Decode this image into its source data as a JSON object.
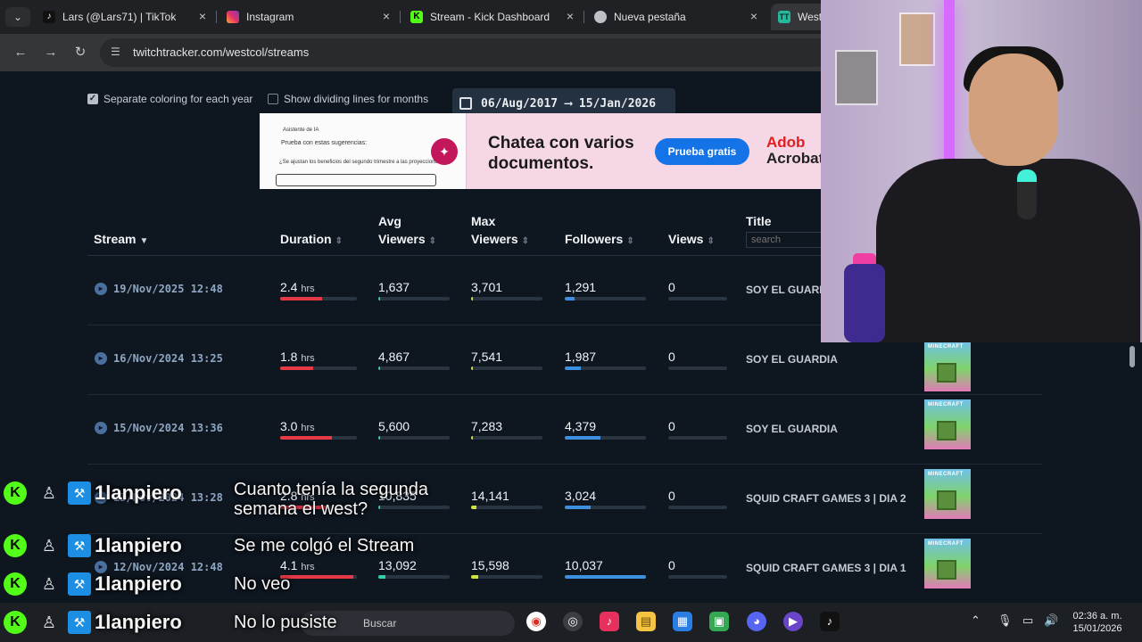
{
  "browser": {
    "tabs": [
      {
        "title": "Lars (@Lars71) | TikTok",
        "favicon": "tiktok-icon"
      },
      {
        "title": "Instagram",
        "favicon": "instagram-icon"
      },
      {
        "title": "Stream - Kick Dashboard",
        "favicon": "kick-icon"
      },
      {
        "title": "Nueva pestaña",
        "favicon": "chrome-icon"
      },
      {
        "title": "West",
        "favicon": "twitchtracker-icon"
      }
    ],
    "url": "twitchtracker.com/westcol/streams"
  },
  "options": {
    "separate_coloring": "Separate coloring for each year",
    "dividing_lines": "Show dividing lines for months",
    "date_from": "06/Aug/2017",
    "date_to": "15/Jan/2026",
    "arrow": "⟶"
  },
  "ad": {
    "shot_title": "Asistente de IA",
    "shot_prompt": "Prueba con estas sugerencias:",
    "shot_line": "¿Se ajustan los beneficios del segundo trimestre a las proyecciones?",
    "headline": "Chatea con varios documentos.",
    "cta": "Prueba gratis",
    "brand1": "Adob",
    "brand2": "Acrobat"
  },
  "table": {
    "headers": {
      "stream": "Stream",
      "duration": "Duration",
      "avg1": "Avg",
      "avg2": "Viewers",
      "max1": "Max",
      "max2": "Viewers",
      "followers": "Followers",
      "views": "Views",
      "title": "Title",
      "search_placeholder": "search"
    },
    "rows": [
      {
        "date": "19/Nov/2025 12:48",
        "duration": "2.4",
        "unit": "hrs",
        "dur_pct": 0.55,
        "avg": "1,637",
        "avg_pct": 0.02,
        "max": "3,701",
        "max_pct": 0.03,
        "followers": "1,291",
        "fol_pct": 0.12,
        "views": "0",
        "title": "SOY EL GUARDI",
        "thumb": false
      },
      {
        "date": "16/Nov/2024 13:25",
        "duration": "1.8",
        "unit": "hrs",
        "dur_pct": 0.43,
        "avg": "4,867",
        "avg_pct": 0.02,
        "max": "7,541",
        "max_pct": 0.03,
        "followers": "1,987",
        "fol_pct": 0.2,
        "views": "0",
        "title": "SOY EL GUARDIA",
        "thumb": true
      },
      {
        "date": "15/Nov/2024 13:36",
        "duration": "3.0",
        "unit": "hrs",
        "dur_pct": 0.68,
        "avg": "5,600",
        "avg_pct": 0.02,
        "max": "7,283",
        "max_pct": 0.03,
        "followers": "4,379",
        "fol_pct": 0.44,
        "views": "0",
        "title": "SOY EL GUARDIA",
        "thumb": true
      },
      {
        "date": "13/Nov/2024 13:28",
        "duration": "2.8",
        "unit": "hrs",
        "dur_pct": 0.6,
        "avg": "10,835",
        "avg_pct": 0.02,
        "max": "14,141",
        "max_pct": 0.08,
        "followers": "3,024",
        "fol_pct": 0.32,
        "views": "0",
        "title": "SQUID CRAFT GAMES 3 | DIA 2",
        "thumb": true
      },
      {
        "date": "12/Nov/2024 12:48",
        "duration": "4.1",
        "unit": "hrs",
        "dur_pct": 0.95,
        "avg": "13,092",
        "avg_pct": 0.1,
        "max": "15,598",
        "max_pct": 0.1,
        "followers": "10,037",
        "fol_pct": 1.0,
        "views": "0",
        "title": "SQUID CRAFT GAMES 3 | DIA 1",
        "thumb": true
      }
    ],
    "thumb_label": "MINECRAFT"
  },
  "colors": {
    "duration_bar": "#e53945",
    "avg_bar": "#2ed1a8",
    "max_bar": "#d2e23a",
    "followers_bar": "#3d8fe0"
  },
  "chat": [
    {
      "user": "1lanpiero",
      "message": "Cuanto tenía la segunda\nsemana el west?"
    },
    {
      "user": "1lanpiero",
      "message": "Se me colgó el Stream"
    },
    {
      "user": "1lanpiero",
      "message": "No veo"
    },
    {
      "user": "1lanpiero",
      "message": "No lo pusiste"
    }
  ],
  "taskbar": {
    "search": "Buscar",
    "time": "02:36 a. m.",
    "date": "15/01/2026"
  }
}
